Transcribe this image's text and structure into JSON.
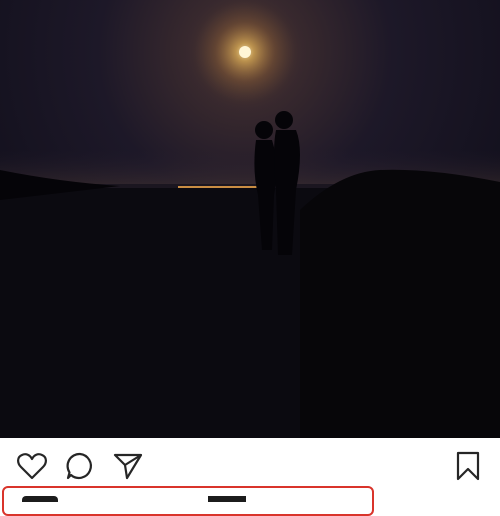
{
  "post": {
    "photo_icon": "photo",
    "accent_color": "#d9342b"
  },
  "actions": {
    "like_icon": "heart-icon",
    "comment_icon": "comment-icon",
    "share_icon": "send-icon",
    "save_icon": "bookmark-icon"
  }
}
